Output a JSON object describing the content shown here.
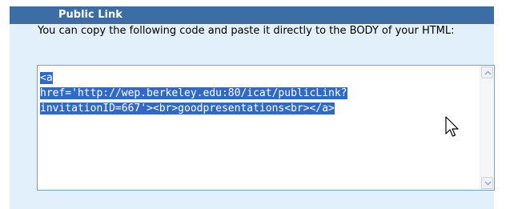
{
  "panel": {
    "title": "Public Link",
    "instructions": "You can copy the following code and paste it directly to the BODY of your HTML:",
    "code_lines": [
      "<a",
      "href='http://wep.berkeley.edu:80/icat/publicLink?",
      "invitationID=667'><br>goodpresentations<br></a>"
    ],
    "selection_color": "#316ac5",
    "header_color": "#3a6ea5",
    "background_color": "#e2f0fb"
  },
  "icons": {
    "scroll_up": "chevron-up-icon",
    "scroll_down": "chevron-down-icon",
    "cursor": "mouse-pointer-icon"
  }
}
